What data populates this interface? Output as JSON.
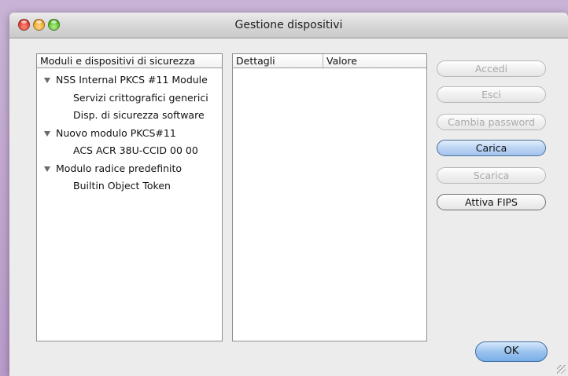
{
  "window": {
    "title": "Gestione dispositivi"
  },
  "tree": {
    "header": "Moduli e dispositivi di sicurezza",
    "items": [
      {
        "label": "NSS Internal PKCS #11 Module",
        "level": 0,
        "expanded": true
      },
      {
        "label": "Servizi crittografici generici",
        "level": 1
      },
      {
        "label": "Disp. di sicurezza software",
        "level": 1
      },
      {
        "label": "Nuovo modulo PKCS#11",
        "level": 0,
        "expanded": true
      },
      {
        "label": "ACS ACR 38U-CCID 00 00",
        "level": 1
      },
      {
        "label": "Modulo radice predefinito",
        "level": 0,
        "expanded": true
      },
      {
        "label": "Builtin Object Token",
        "level": 1
      }
    ]
  },
  "details": {
    "col_details": "Dettagli",
    "col_value": "Valore"
  },
  "buttons": {
    "accedi": "Accedi",
    "esci": "Esci",
    "cambia_password": "Cambia password",
    "carica": "Carica",
    "scarica": "Scarica",
    "attiva_fips": "Attiva FIPS",
    "ok": "OK"
  },
  "icons": {
    "close": "close-icon",
    "minimize": "minimize-icon",
    "zoom": "zoom-icon",
    "disclosure": "disclosure-triangle-icon",
    "resize": "resize-grip-icon"
  },
  "colors": {
    "default_button": "#a4c4ee",
    "desktop": "#c9b3d6"
  }
}
